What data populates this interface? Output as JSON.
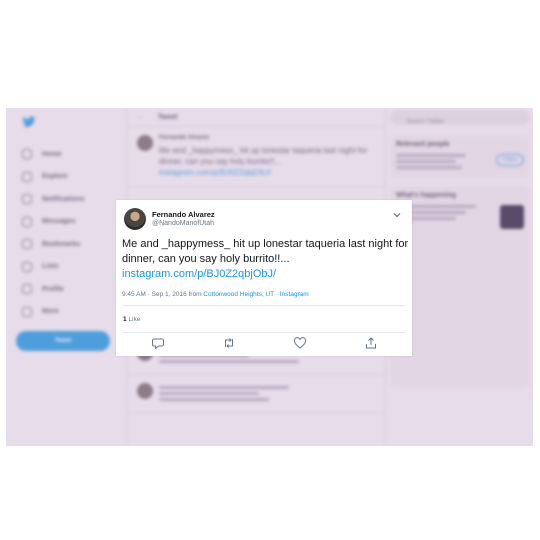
{
  "background": {
    "nav": [
      "Home",
      "Explore",
      "Notifications",
      "Messages",
      "Bookmarks",
      "Lists",
      "Profile",
      "More"
    ],
    "tweet_button": "Tweet",
    "header_title": "Tweet",
    "blurred_tweet_author": "Fernando Alvarez",
    "blurred_tweet_text": "Me and _happymess_ hit up lonestar taqueria last night for dinner, can you say holy burrito!!...",
    "blurred_tweet_link": "instagram.com/p/BJ0Z2qbjObJ/",
    "search_placeholder": "Search Twitter",
    "relevant_people_title": "Relevant people",
    "follow_label": "Follow",
    "happening_title": "What's happening"
  },
  "card": {
    "name": "Fernando Alvarez",
    "handle": "@NandoManofUtah",
    "text": "Me and _happymess_ hit up lonestar taqueria last night for dinner, can you say holy burrito!!...",
    "link": "instagram.com/p/BJ0Z2qbjObJ/",
    "time": "9:45 AM · Sep 1, 2016 from ",
    "location": "Cottonwood Heights, UT",
    "source_sep": " · ",
    "source": "Instagram",
    "like_count": "1",
    "like_label": "Like",
    "actions": [
      "reply-icon",
      "retweet-icon",
      "like-icon",
      "share-icon"
    ]
  },
  "colors": {
    "link": "#1b95e0",
    "secondary_text": "#657786",
    "background_tint": "#e7dcea"
  }
}
